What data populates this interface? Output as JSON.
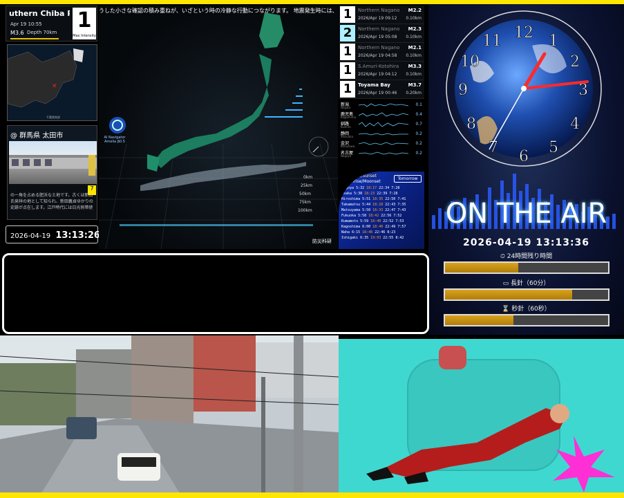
{
  "eq": {
    "location": "uthern Chiba P",
    "time": "Apr 19 10:55",
    "magnitude": "M3.6",
    "depth": "Depth 70km",
    "intensity": "1",
    "intensity_label": "Max Intensity"
  },
  "camera": {
    "title": "@ 群馬県 太田市",
    "caption": "の一角を占める肥沃な土地です。古くは新田氏発祥の地として知られ、新田義貞ゆかりの史跡が点在します。江戸時代には日光例幣使",
    "badge": "7"
  },
  "clock": {
    "date": "2026-04-19",
    "time": "13:13:26"
  },
  "ticker": "うした小さな確認の積み重ねが、いざという時の冷静な行動につながります。 地震発生時には、まず身",
  "map": {
    "ai_nav": "AI Navigator Amelia β0.5",
    "logo": "防災科研"
  },
  "eq_list": [
    {
      "n": "1",
      "loc": "Northern Nagano P",
      "dt": "2026/Apr 19 09:12",
      "m": "M2.2",
      "d": "0.10km"
    },
    {
      "n": "2",
      "loc": "Northern Nagano P",
      "dt": "2026/Apr 19 05:08",
      "m": "M2.3",
      "d": "0.10km"
    },
    {
      "n": "1",
      "loc": "Northern Nagano P",
      "dt": "2026/Apr 19 04:58",
      "m": "M2.1",
      "d": "0.10km"
    },
    {
      "n": "1",
      "loc": "S.Amuri-Kotohira Rikomi",
      "dt": "2026/Apr 19 04:12",
      "m": "M3.3",
      "d": "0.10km"
    },
    {
      "n": "1",
      "loc": "Toyama Bay",
      "dt": "2026/Apr 19 00:46",
      "m": "M3.7",
      "d": "0.20km"
    }
  ],
  "waves": [
    {
      "name": "新潟",
      "sub": "Niigata",
      "v": "0.1"
    },
    {
      "name": "鹿児島",
      "sub": "Kagoshima",
      "v": "0.4"
    },
    {
      "name": "釧路",
      "sub": "Kushiro",
      "v": "0.7"
    },
    {
      "name": "静岡",
      "sub": "Shizuoka",
      "v": "0.2"
    },
    {
      "name": "金沢",
      "sub": "Kanazawa",
      "v": "0.2"
    },
    {
      "name": "名古屋",
      "sub": "Nagoya",
      "v": "0.2"
    }
  ],
  "sun": {
    "heading1": "Sunrise/Sunset",
    "heading2": "Moonrise/Moonset",
    "tomorrow": "Tomorrow",
    "rows": [
      {
        "city": "Nagoya",
        "a": "5:32",
        "b": "18:17",
        "c": "22:34",
        "d": "7:28"
      },
      {
        "city": "Osaka",
        "a": "5:38",
        "b": "18:23",
        "c": "22:39",
        "d": "7:28"
      },
      {
        "city": "Hiroshima",
        "a": "5:51",
        "b": "18:35",
        "c": "22:50",
        "d": "7:41"
      },
      {
        "city": "Takamatsu",
        "a": "5:44",
        "b": "18:28",
        "c": "22:43",
        "d": "7:35"
      },
      {
        "city": "Matsuyama",
        "a": "5:50",
        "b": "18:33",
        "c": "22:47",
        "d": "7:43"
      },
      {
        "city": "Fukuoka",
        "a": "5:58",
        "b": "18:42",
        "c": "22:56",
        "d": "7:52"
      },
      {
        "city": "Kumamoto",
        "a": "5:59",
        "b": "18:40",
        "c": "22:52",
        "d": "7:53"
      },
      {
        "city": "Kagoshima",
        "a": "6:00",
        "b": "18:40",
        "c": "22:49",
        "d": "7:57"
      },
      {
        "city": "Naha",
        "a": "6:15",
        "b": "18:48",
        "c": "22:46",
        "d": "8:23"
      },
      {
        "city": "Ishigaki",
        "a": "6:35",
        "b": "19:03",
        "c": "22:55",
        "d": "8:42"
      }
    ]
  },
  "right": {
    "onair": "ON THE AIR",
    "datetime": "2026-04-19 13:13:36",
    "bars": [
      {
        "label": "24時間残り時間",
        "icon": "clock-icon",
        "fill": 0.45
      },
      {
        "label": "長針（60分）",
        "icon": "monitor-icon",
        "fill": 0.78
      },
      {
        "label": "秒針（60秒）",
        "icon": "hourglass-icon",
        "fill": 0.42
      }
    ]
  }
}
